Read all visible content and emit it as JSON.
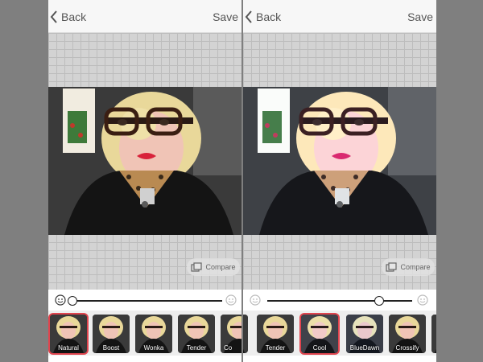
{
  "panels": [
    {
      "nav": {
        "back_label": "Back",
        "save_label": "Save"
      },
      "compare_label": "Compare",
      "filters": [
        {
          "label": "Natural",
          "selected": true
        },
        {
          "label": "Boost",
          "selected": false
        },
        {
          "label": "Wonka",
          "selected": false
        },
        {
          "label": "Tender",
          "selected": false
        },
        {
          "label": "Co",
          "selected": false
        }
      ],
      "slider": {
        "value": 0
      }
    },
    {
      "nav": {
        "back_label": "Back",
        "save_label": "Save"
      },
      "compare_label": "Compare",
      "filters": [
        {
          "label": "",
          "selected": false
        },
        {
          "label": "Tender",
          "selected": false
        },
        {
          "label": "Cool",
          "selected": true
        },
        {
          "label": "BlueDawn",
          "selected": false
        },
        {
          "label": "Crossify",
          "selected": false
        },
        {
          "label": "",
          "selected": false
        }
      ],
      "slider": {
        "value": 0.77
      }
    }
  ],
  "colors": {
    "selected_ring": "#e0444e",
    "background": "#7f7f7f"
  },
  "icons": [
    "chevron-left-icon",
    "compare-icon",
    "smile-icon"
  ]
}
